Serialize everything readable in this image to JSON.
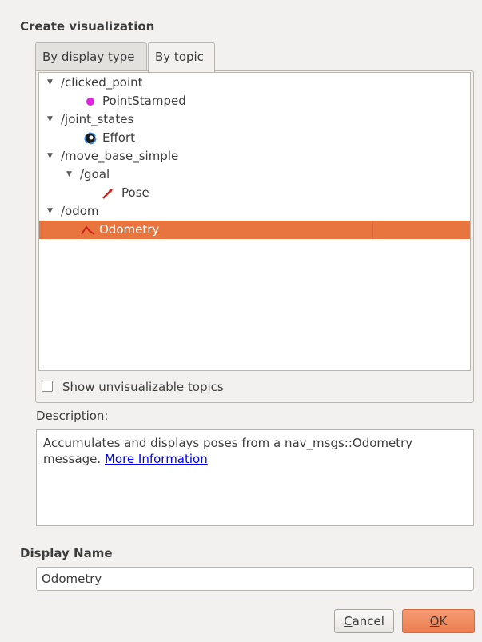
{
  "dialog": {
    "create_title": "Create visualization",
    "display_name_title": "Display Name"
  },
  "tabs": [
    {
      "label": "By display type",
      "active": false
    },
    {
      "label": "By topic",
      "active": true
    }
  ],
  "tree": {
    "rows": [
      {
        "text": "/clicked_point",
        "expander": "▼",
        "icon": null,
        "selected": false
      },
      {
        "text": "PointStamped",
        "expander": null,
        "icon": "magenta-dot-icon",
        "selected": false
      },
      {
        "text": "/joint_states",
        "expander": "▼",
        "icon": null,
        "selected": false
      },
      {
        "text": "Effort",
        "expander": null,
        "icon": "effort-icon",
        "selected": false
      },
      {
        "text": "/move_base_simple",
        "expander": "▼",
        "icon": null,
        "selected": false
      },
      {
        "text": "/goal",
        "expander": "▼",
        "icon": null,
        "selected": false
      },
      {
        "text": "Pose",
        "expander": null,
        "icon": "pose-arrow-icon",
        "selected": false
      },
      {
        "text": "/odom",
        "expander": "▼",
        "icon": null,
        "selected": false
      },
      {
        "text": "Odometry",
        "expander": null,
        "icon": "odometry-icon",
        "selected": true
      }
    ]
  },
  "options": {
    "show_unvisualizable_label": "Show unvisualizable topics",
    "show_unvisualizable_checked": false
  },
  "description": {
    "label": "Description:",
    "text": "Accumulates and displays poses from a nav_msgs::Odometry message. ",
    "link_text": "More Information"
  },
  "display_name": {
    "value": "Odometry"
  },
  "buttons": {
    "cancel_label": "Cancel",
    "ok_label": "OK"
  },
  "colors": {
    "selection": "#e9753e",
    "ok_button": "#ec7f52",
    "link": "#0000ee"
  }
}
